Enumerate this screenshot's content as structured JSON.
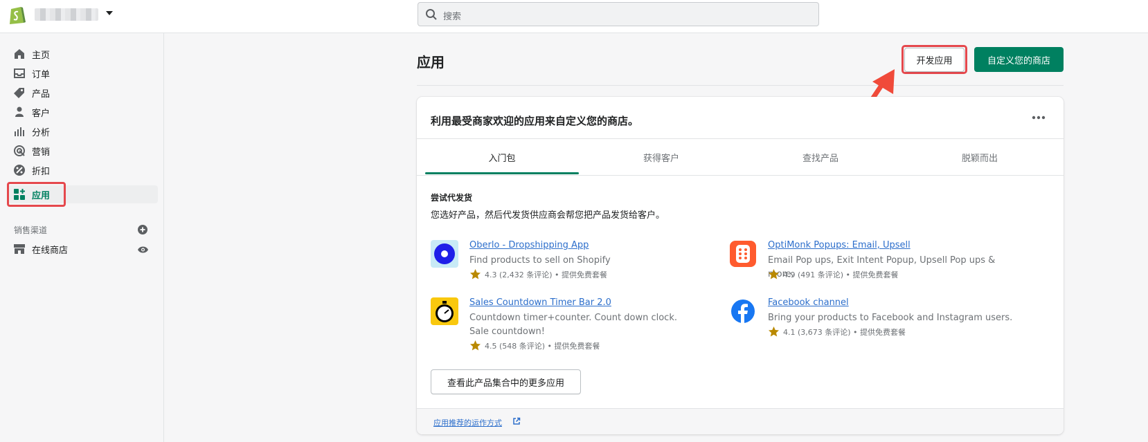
{
  "topbar": {
    "search_placeholder": "搜索",
    "brand_color": "#95bf47"
  },
  "sidebar": {
    "items": [
      {
        "label": "主页",
        "icon": "home-icon"
      },
      {
        "label": "订单",
        "icon": "inbox-icon"
      },
      {
        "label": "产品",
        "icon": "tag-icon"
      },
      {
        "label": "客户",
        "icon": "person-icon"
      },
      {
        "label": "分析",
        "icon": "bar-chart-icon"
      },
      {
        "label": "营销",
        "icon": "target-icon"
      },
      {
        "label": "折扣",
        "icon": "discount-icon"
      },
      {
        "label": "应用",
        "icon": "apps-icon",
        "active": true
      }
    ],
    "sales_channels_label": "销售渠道",
    "channels": [
      {
        "label": "在线商店",
        "icon": "store-icon"
      }
    ]
  },
  "main": {
    "title": "应用",
    "develop_apps_label": "开发应用",
    "customize_store_label": "自定义您的商店",
    "accent_color": "#008060"
  },
  "card": {
    "title": "利用最受商家欢迎的应用来自定义您的商店。",
    "tabs": [
      "入门包",
      "获得客户",
      "查找产品",
      "脱颖而出"
    ],
    "active_tab": 0,
    "section_title": "尝试代发货",
    "section_desc": "您选好产品，然后代发货供应商会帮您把产品发货给客户。",
    "apps": [
      {
        "name": "Oberlo - Dropshipping App",
        "desc": "Find products to sell on Shopify",
        "rating": "4.3 (2,432 条评论) • 提供免费套餐"
      },
      {
        "name": "OptiMonk Popups: Email, Upsell",
        "desc": "Email Pop ups, Exit Intent Popup, Upsell Pop ups & more.",
        "rating": "4.9 (491 条评论) • 提供免费套餐"
      },
      {
        "name": "Sales Countdown Timer Bar 2.0",
        "desc": "Countdown timer+counter. Count down clock. Sale countdown!",
        "rating": "4.5 (548 条评论) • 提供免费套餐"
      },
      {
        "name": "Facebook channel",
        "desc": "Bring your products to Facebook and Instagram users.",
        "rating": "4.1 (3,673 条评论) • 提供免费套餐"
      }
    ],
    "more_apps_label": "查看此产品集合中的更多应用",
    "footer_link": "应用推荐的运作方式"
  }
}
